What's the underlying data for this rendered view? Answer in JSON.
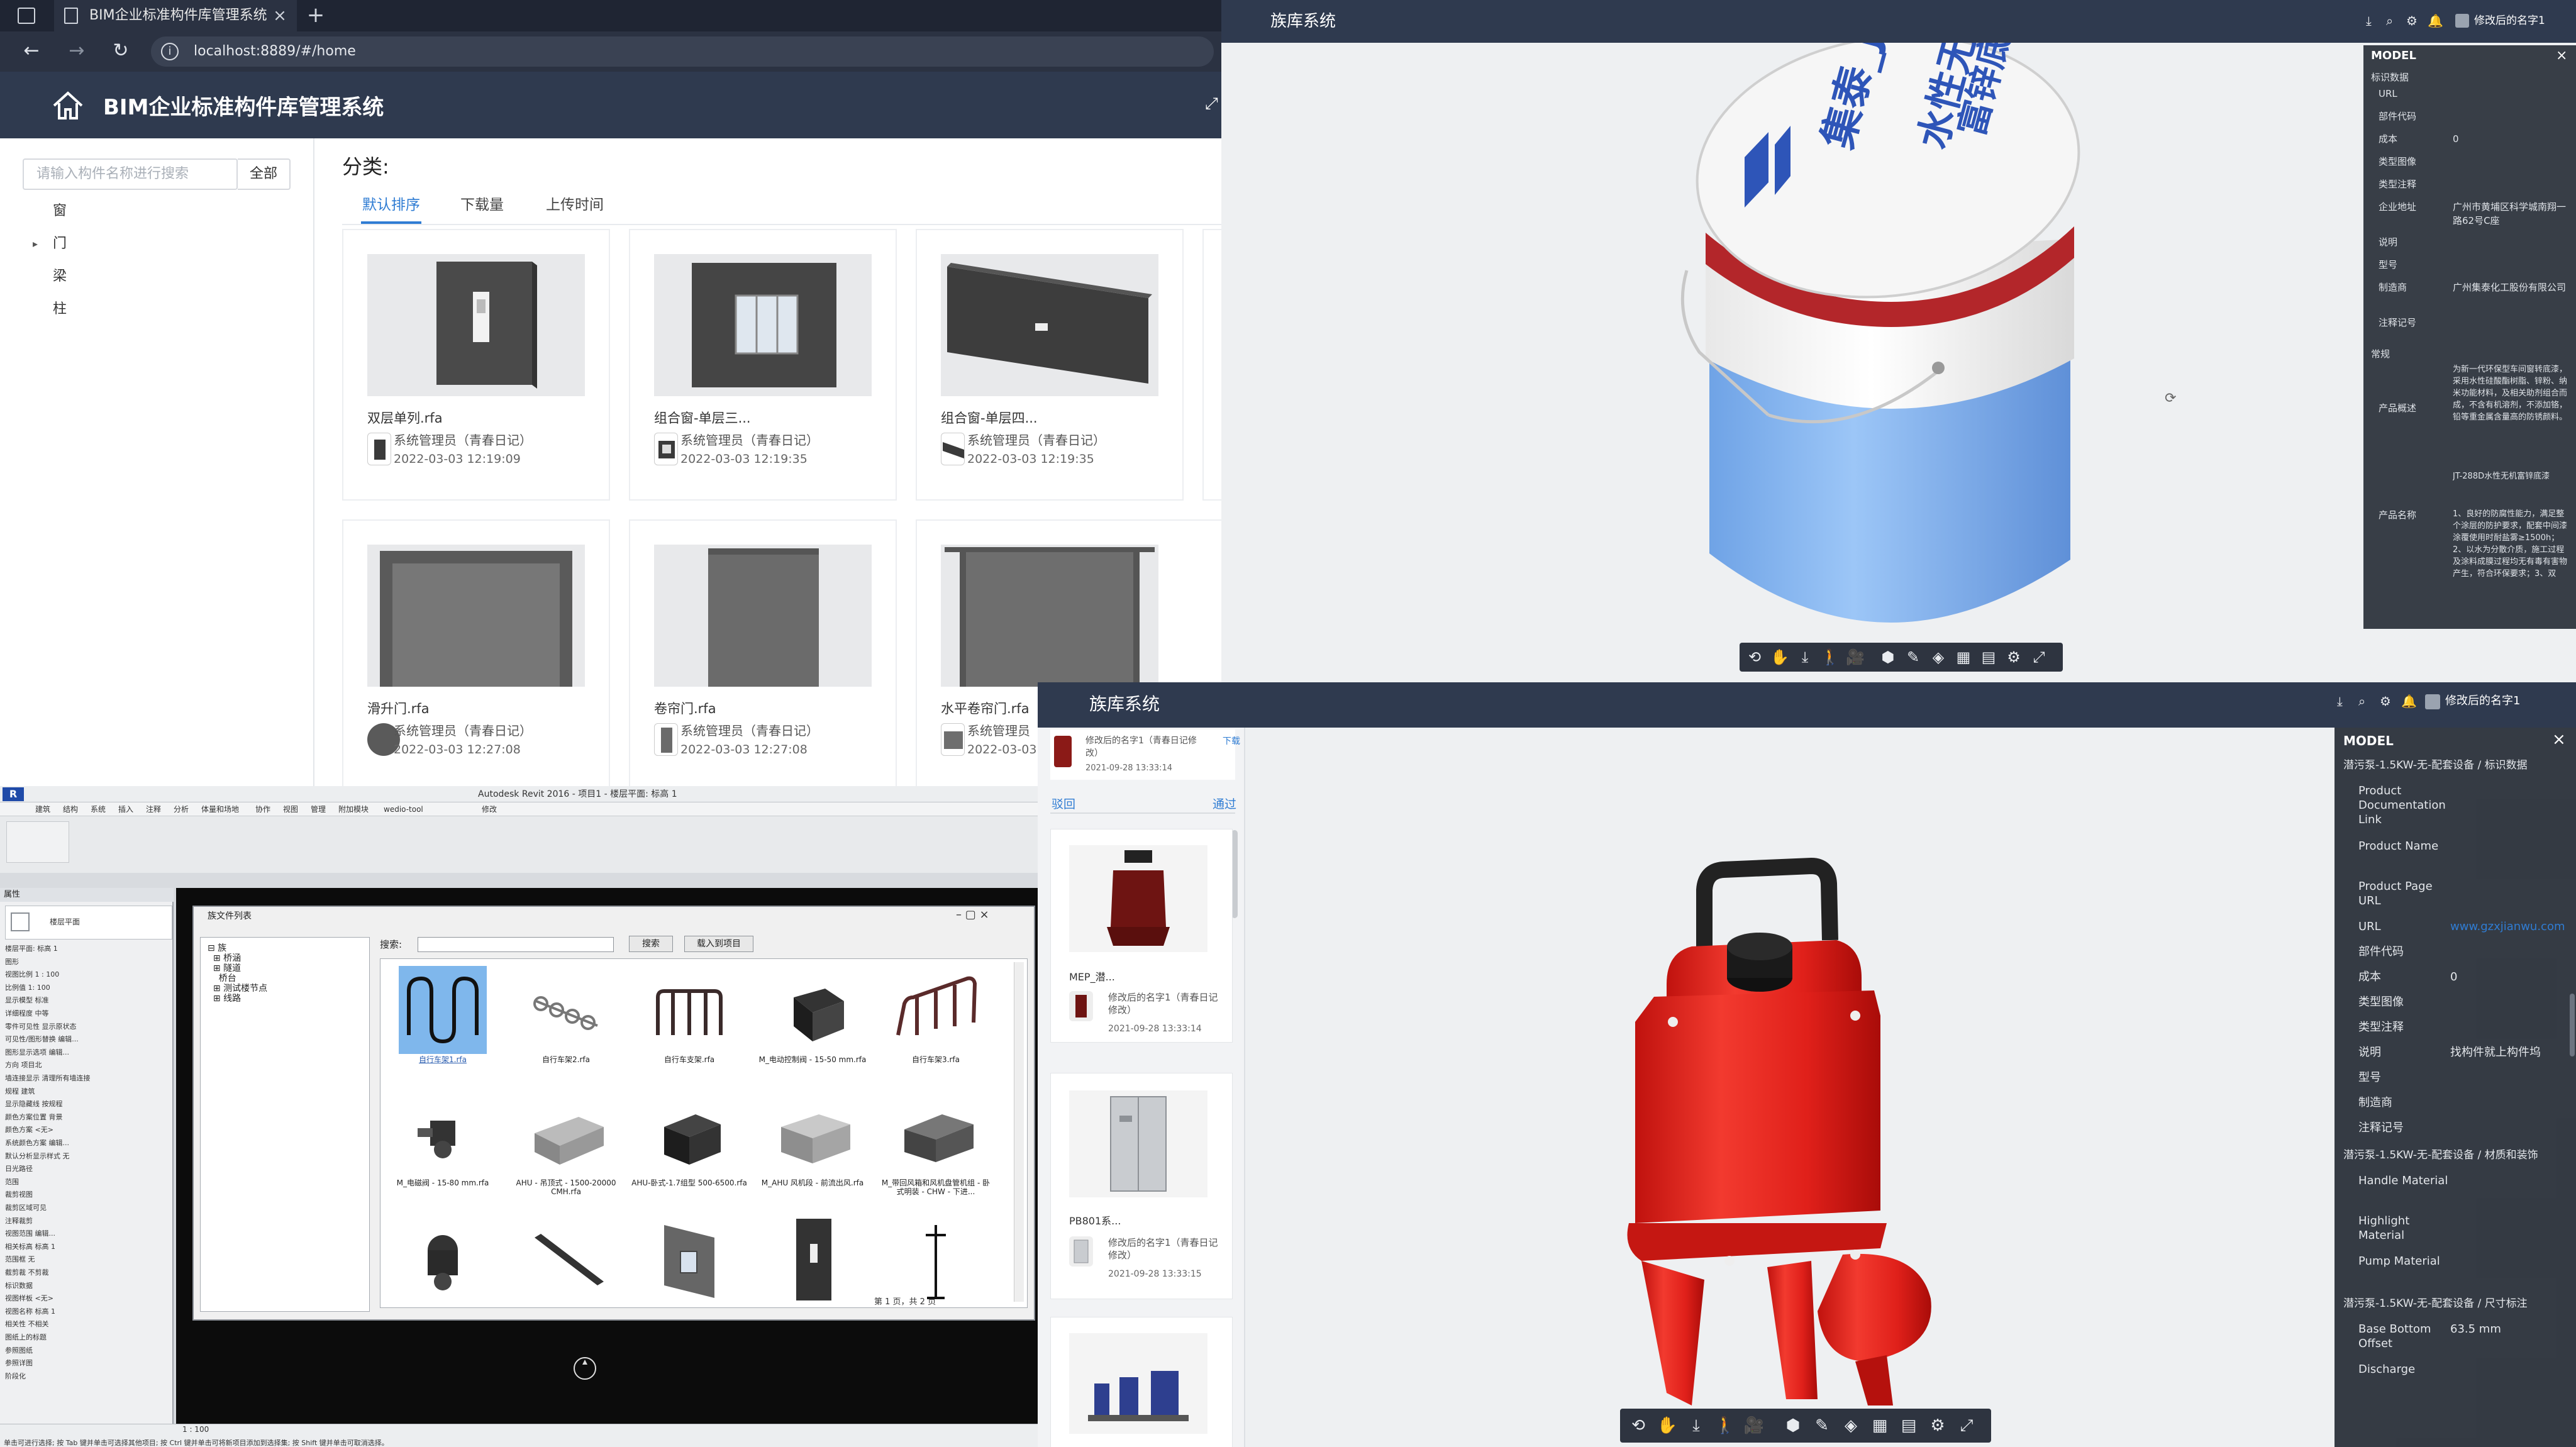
{
  "browser": {
    "tab_title": "BIM企业标准构件库管理系统",
    "tab_close": "×",
    "new_tab": "+",
    "url": "localhost:8889/#/home",
    "nav": {
      "back": "←",
      "forward": "→",
      "reload": "↻",
      "info": "i"
    }
  },
  "app": {
    "title": "BIM企业标准构件库管理系统",
    "search": {
      "placeholder": "请输入构件名称进行搜索",
      "all_button": "全部"
    },
    "tree": [
      "窗",
      "门",
      "梁",
      "柱"
    ],
    "tree_caret": "▸",
    "category_label": "分类:",
    "sort_tabs": [
      "默认排序",
      "下载量",
      "上传时间"
    ],
    "cards": [
      {
        "name": "双层单列.rfa",
        "author": "系统管理员（青春日记）",
        "date": "2022-03-03 12:19:09"
      },
      {
        "name": "组合窗-单层三...",
        "author": "系统管理员（青春日记）",
        "date": "2022-03-03 12:19:35"
      },
      {
        "name": "组合窗-单层四...",
        "author": "系统管理员（青春日记）",
        "date": "2022-03-03 12:19:35"
      },
      {
        "name": "滑升门.rfa",
        "author": "系统管理员（青春日记）",
        "date": "2022-03-03 12:27:08"
      },
      {
        "name": "卷帘门.rfa",
        "author": "系统管理员（青春日记）",
        "date": "2022-03-03 12:27:08"
      },
      {
        "name": "水平卷帘门.rfa",
        "author": "系统管理员",
        "date": "2022-03-03"
      }
    ]
  },
  "viewer_top": {
    "title": "族库系统",
    "user": "修改后的名字1",
    "toolbar_icons": [
      "⟲",
      "✋",
      "⤓",
      "🚶",
      "🎥",
      "⬢",
      "✎",
      "◈",
      "▦",
      "▤",
      "⚙",
      "⤢"
    ],
    "panel": {
      "title": "MODEL",
      "close": "×",
      "section": "标识数据",
      "rows": [
        {
          "label": "URL",
          "value": ""
        },
        {
          "label": "部件代码",
          "value": ""
        },
        {
          "label": "成本",
          "value": "0"
        },
        {
          "label": "类型图像",
          "value": ""
        },
        {
          "label": "类型注释",
          "value": ""
        },
        {
          "label": "企业地址",
          "value": "广州市黄埔区科学城南翔一路62号C座"
        },
        {
          "label": "说明",
          "value": ""
        },
        {
          "label": "型号",
          "value": ""
        },
        {
          "label": "制造商",
          "value": "广州集泰化工股份有限公司"
        },
        {
          "label": "注释记号",
          "value": ""
        }
      ],
      "section2": "常规",
      "rows2": [
        {
          "label": "产品概述",
          "value": "为新一代环保型车间窗转底漆，采用水性硅酸酯树脂、锌粉、纳米功能材料，及相关助剂组合而成，不含有机溶剂，不添加铬，铅等重金属含量高的防锈颜料。"
        },
        {
          "label": "产品名称",
          "value": "JT-288D水性无机富锌底漆"
        },
        {
          "label": "",
          "value": "1、良好的防腐性能力，满足整个涂层的防护要求，配套中间漆涂覆使用时耐盐雾≥1500h；2、以水为分散介质，施工过程及涂料成膜过程均无有毒有害物产生，符合环保要求；3、双"
        }
      ]
    },
    "bucket_text": {
      "brand": "集泰_JT-288D",
      "line2": "水性无机",
      "line3": "富锌底漆"
    }
  },
  "revit": {
    "title": "Autodesk Revit 2016 - 项目1 - 楼层平面: 标高 1",
    "menu": [
      "建筑",
      "结构",
      "系统",
      "插入",
      "注释",
      "分析",
      "体量和场地",
      "协作",
      "视图",
      "管理",
      "附加模块",
      "wedio-tool",
      "修改"
    ],
    "props_title": "属性",
    "props_type": "楼层平面",
    "props_rows": [
      "楼层平面: 标高 1",
      "图形",
      "视图比例  1 : 100",
      "比例值 1: 100",
      "显示模型  标准",
      "详细程度  中等",
      "零件可见性 显示原状态",
      "可见性/图形替换 编辑...",
      "图形显示选项 编辑...",
      "方向  项目北",
      "墙连接显示 清理所有墙连接",
      "规程  建筑",
      "显示隐藏线 按规程",
      "颜色方案位置 背景",
      "颜色方案  <无>",
      "系统颜色方案 编辑...",
      "默认分析显示样式 无",
      "日光路径",
      "范围",
      "裁剪视图",
      "裁剪区域可见",
      "注释裁剪",
      "视图范围 编辑...",
      "相关标高 标高 1",
      "范围框  无",
      "截剪裁  不剪裁",
      "标识数据",
      "视图样板 <无>",
      "视图名称 标高 1",
      "相关性  不相关",
      "图纸上的标题",
      "参照图纸",
      "参照详图",
      "阶段化"
    ],
    "dialog": {
      "title": "族文件列表",
      "ctrl": "–  ▢  ×",
      "tree": [
        "⊟ 族",
        "  ⊞ 桥涵",
        "  ⊞ 隧道",
        "    桥台",
        "  ⊞ 测试楼节点",
        "  ⊞ 线路"
      ],
      "search_label": "搜索:",
      "search_button": "搜索",
      "load_button": "载入到项目",
      "families": [
        "自行车架1.rfa",
        "自行车架2.rfa",
        "自行车支架.rfa",
        "M_电动控制阀 - 15-50 mm.rfa",
        "自行车架3.rfa",
        "M_电磁阀 - 15-80 mm.rfa",
        "AHU - 吊顶式 - 1500-20000 CMH.rfa",
        "AHU-卧式-1.7组型 500-6500.rfa",
        "M_AHU 风机段 - 前流出风.rfa",
        "M_带回风箱和风机盘管机组 - 卧式明装 - CHW - 下进...",
        "",
        "",
        "",
        "",
        ""
      ],
      "pager": "第  1  页，共 2 页"
    },
    "status": "单击可进行选择; 按 Tab 键并单击可选择其他项目; 按 Ctrl 键并单击可将新项目添加到选择集; 按 Shift 键并单击可取消选择。",
    "scale": "1 : 100"
  },
  "viewer_bottom": {
    "title": "族库系统",
    "user": "修改后的名字1",
    "review": {
      "author": "修改后的名字1（青春日记修改）",
      "date": "2021-09-28 13:33:14",
      "download": "下载",
      "reject": "驳回",
      "approve": "通过"
    },
    "items": [
      {
        "name": "MEP_潜...",
        "author": "修改后的名字1（青春日记修改）",
        "date": "2021-09-28 13:33:14"
      },
      {
        "name": "PB801系...",
        "author": "修改后的名字1（青春日记修改）",
        "date": "2021-09-28 13:33:15"
      }
    ],
    "toolbar_icons": [
      "⟲",
      "✋",
      "⤓",
      "🚶",
      "🎥",
      "⬢",
      "✎",
      "◈",
      "▦",
      "▤",
      "⚙",
      "⤢"
    ],
    "panel": {
      "title": "MODEL",
      "close": "×",
      "sections": [
        {
          "header": "潜污泵-1.5KW-无-配套设备 / 标识数据",
          "rows": [
            {
              "label": "Product Documentation Link",
              "value": ""
            },
            {
              "label": "Product Name",
              "value": ""
            },
            {
              "label": "Product Page URL",
              "value": ""
            },
            {
              "label": "URL",
              "value": "www.gzxjianwu.com"
            },
            {
              "label": "部件代码",
              "value": ""
            },
            {
              "label": "成本",
              "value": "0"
            },
            {
              "label": "类型图像",
              "value": ""
            },
            {
              "label": "类型注释",
              "value": ""
            },
            {
              "label": "说明",
              "value": "找构件就上构件坞"
            },
            {
              "label": "型号",
              "value": ""
            },
            {
              "label": "制造商",
              "value": ""
            },
            {
              "label": "注释记号",
              "value": ""
            }
          ]
        },
        {
          "header": "潜污泵-1.5KW-无-配套设备 / 材质和装饰",
          "rows": [
            {
              "label": "Handle Material",
              "value": ""
            },
            {
              "label": "Highlight Material",
              "value": ""
            },
            {
              "label": "Pump Material",
              "value": ""
            }
          ]
        },
        {
          "header": "潜污泵-1.5KW-无-配套设备 / 尺寸标注",
          "rows": [
            {
              "label": "Base Bottom Offset",
              "value": "63.5 mm"
            },
            {
              "label": "Discharge",
              "value": ""
            }
          ]
        }
      ]
    }
  },
  "colors": {
    "header": "#2f3a4f",
    "accent": "#2f7cd3",
    "pump_red": "#e8231f",
    "bucket_blue": "#7fb2f0"
  }
}
